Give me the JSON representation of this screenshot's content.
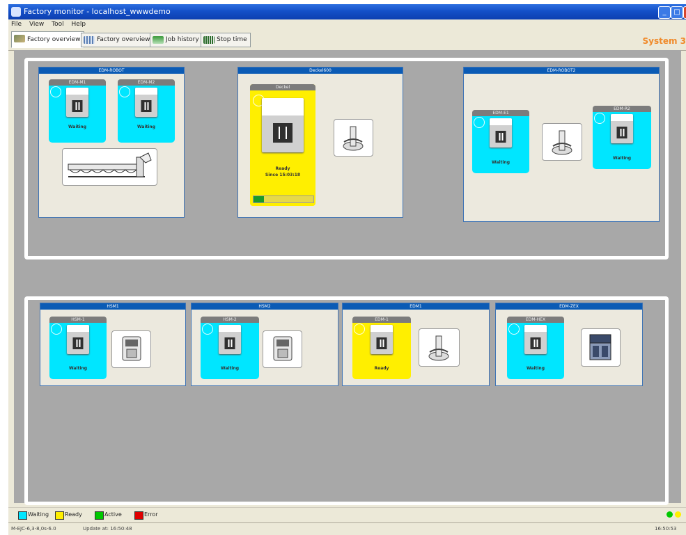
{
  "window": {
    "title": "Factory monitor - localhost_wwwdemo"
  },
  "menu": [
    "File",
    "View",
    "Tool",
    "Help"
  ],
  "tabs": [
    {
      "label": "Factory overview",
      "active": true
    },
    {
      "label": "Factory overview",
      "active": false
    },
    {
      "label": "Job history",
      "active": false
    },
    {
      "label": "Stop time",
      "active": false
    }
  ],
  "system_label": "System 3",
  "groups": {
    "g1": {
      "title": "EDM-ROBOT",
      "m1": {
        "name": "EDM-M1",
        "status": "Waiting"
      },
      "m2": {
        "name": "EDM-M2",
        "status": "Waiting"
      }
    },
    "g2": {
      "title": "Deckel600",
      "m1": {
        "name": "Deckel",
        "status": "Ready",
        "since": "Since 15:03:18",
        "progress": 0.18
      }
    },
    "g3": {
      "title": "EDM-ROBOT2",
      "m1": {
        "name": "EDM-E1",
        "status": "Waiting"
      },
      "m2": {
        "name": "EDM-R2",
        "status": "Waiting"
      }
    },
    "g4": {
      "title": "HSM1",
      "m1": {
        "name": "HSM-1",
        "status": "Waiting"
      }
    },
    "g5": {
      "title": "HSM2",
      "m1": {
        "name": "HSM-2",
        "status": "Waiting"
      }
    },
    "g6": {
      "title": "EDM1",
      "m1": {
        "name": "EDM-1",
        "status": "Ready"
      }
    },
    "g7": {
      "title": "EDM-ZEX",
      "m1": {
        "name": "EDM-HEX",
        "status": "Waiting"
      }
    }
  },
  "legend": [
    {
      "label": "Waiting",
      "color": "#00e6ff"
    },
    {
      "label": "Ready",
      "color": "#ffef00"
    },
    {
      "label": "Active",
      "color": "#00c800"
    },
    {
      "label": "Error",
      "color": "#e00000"
    }
  ],
  "status": {
    "left": "M-EJC-6,3-8,0s-6.0",
    "update": "Update at: 16:50:48",
    "time": "16:50:53"
  },
  "colors": {
    "waiting": "#00e6ff",
    "ready": "#ffef00",
    "active": "#00c800",
    "error": "#e00000",
    "accent": "#f08a2a"
  }
}
